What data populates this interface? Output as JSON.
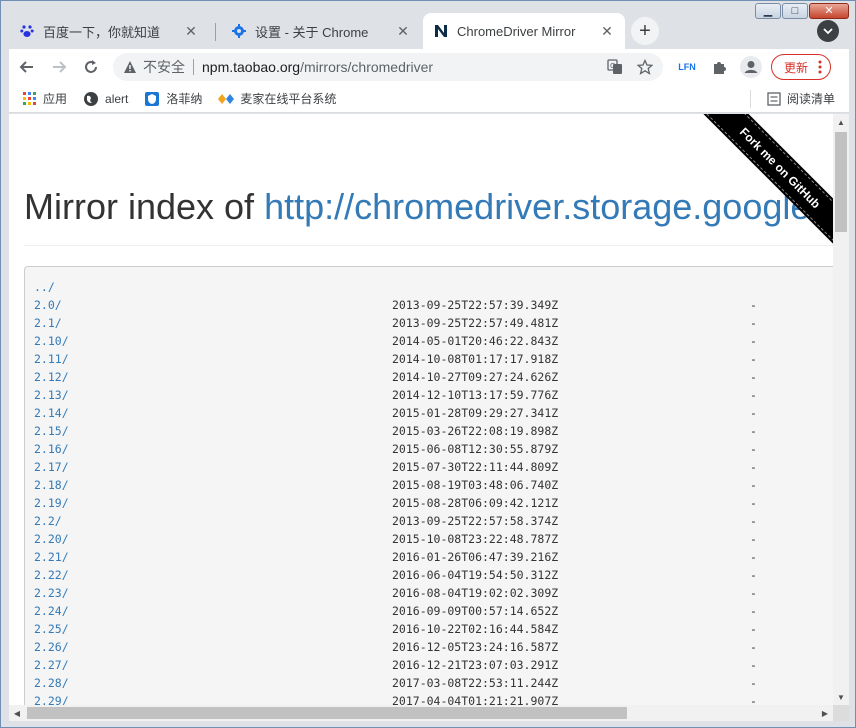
{
  "tabs": [
    {
      "title": "百度一下，你就知道",
      "favicon": "baidu-paw-icon"
    },
    {
      "title": "设置 - 关于 Chrome",
      "favicon": "settings-gear-icon"
    },
    {
      "title": "ChromeDriver Mirror",
      "favicon": "npm-n-icon"
    }
  ],
  "toolbar": {
    "insecure_label": "不安全",
    "url_host": "npm.taobao.org",
    "url_path": "/mirrors/chromedriver",
    "lfn_label": "LFN",
    "update_label": "更新"
  },
  "bookmarks": [
    {
      "label": "应用",
      "icon": "apps-grid-icon"
    },
    {
      "label": "alert",
      "icon": "globe-icon"
    },
    {
      "label": "洛菲纳",
      "icon": "shield-icon"
    },
    {
      "label": "麦家在线平台系统",
      "icon": "diamond-logo-icon"
    }
  ],
  "reading_list_label": "阅读清单",
  "page": {
    "heading_prefix": "Mirror index of ",
    "heading_link": "http://chromedriver.storage.googleapis.com/",
    "ribbon": "Fork me on GitHub",
    "parent_link": "../",
    "entries": [
      {
        "name": "2.0/",
        "date": "2013-09-25T22:57:39.349Z",
        "size": "-"
      },
      {
        "name": "2.1/",
        "date": "2013-09-25T22:57:49.481Z",
        "size": "-"
      },
      {
        "name": "2.10/",
        "date": "2014-05-01T20:46:22.843Z",
        "size": "-"
      },
      {
        "name": "2.11/",
        "date": "2014-10-08T01:17:17.918Z",
        "size": "-"
      },
      {
        "name": "2.12/",
        "date": "2014-10-27T09:27:24.626Z",
        "size": "-"
      },
      {
        "name": "2.13/",
        "date": "2014-12-10T13:17:59.776Z",
        "size": "-"
      },
      {
        "name": "2.14/",
        "date": "2015-01-28T09:29:27.341Z",
        "size": "-"
      },
      {
        "name": "2.15/",
        "date": "2015-03-26T22:08:19.898Z",
        "size": "-"
      },
      {
        "name": "2.16/",
        "date": "2015-06-08T12:30:55.879Z",
        "size": "-"
      },
      {
        "name": "2.17/",
        "date": "2015-07-30T22:11:44.809Z",
        "size": "-"
      },
      {
        "name": "2.18/",
        "date": "2015-08-19T03:48:06.740Z",
        "size": "-"
      },
      {
        "name": "2.19/",
        "date": "2015-08-28T06:09:42.121Z",
        "size": "-"
      },
      {
        "name": "2.2/",
        "date": "2013-09-25T22:57:58.374Z",
        "size": "-"
      },
      {
        "name": "2.20/",
        "date": "2015-10-08T23:22:48.787Z",
        "size": "-"
      },
      {
        "name": "2.21/",
        "date": "2016-01-26T06:47:39.216Z",
        "size": "-"
      },
      {
        "name": "2.22/",
        "date": "2016-06-04T19:54:50.312Z",
        "size": "-"
      },
      {
        "name": "2.23/",
        "date": "2016-08-04T19:02:02.309Z",
        "size": "-"
      },
      {
        "name": "2.24/",
        "date": "2016-09-09T00:57:14.652Z",
        "size": "-"
      },
      {
        "name": "2.25/",
        "date": "2016-10-22T02:16:44.584Z",
        "size": "-"
      },
      {
        "name": "2.26/",
        "date": "2016-12-05T23:24:16.587Z",
        "size": "-"
      },
      {
        "name": "2.27/",
        "date": "2016-12-21T23:07:03.291Z",
        "size": "-"
      },
      {
        "name": "2.28/",
        "date": "2017-03-08T22:53:11.244Z",
        "size": "-"
      },
      {
        "name": "2.29/",
        "date": "2017-04-04T01:21:21.907Z",
        "size": "-"
      }
    ]
  }
}
